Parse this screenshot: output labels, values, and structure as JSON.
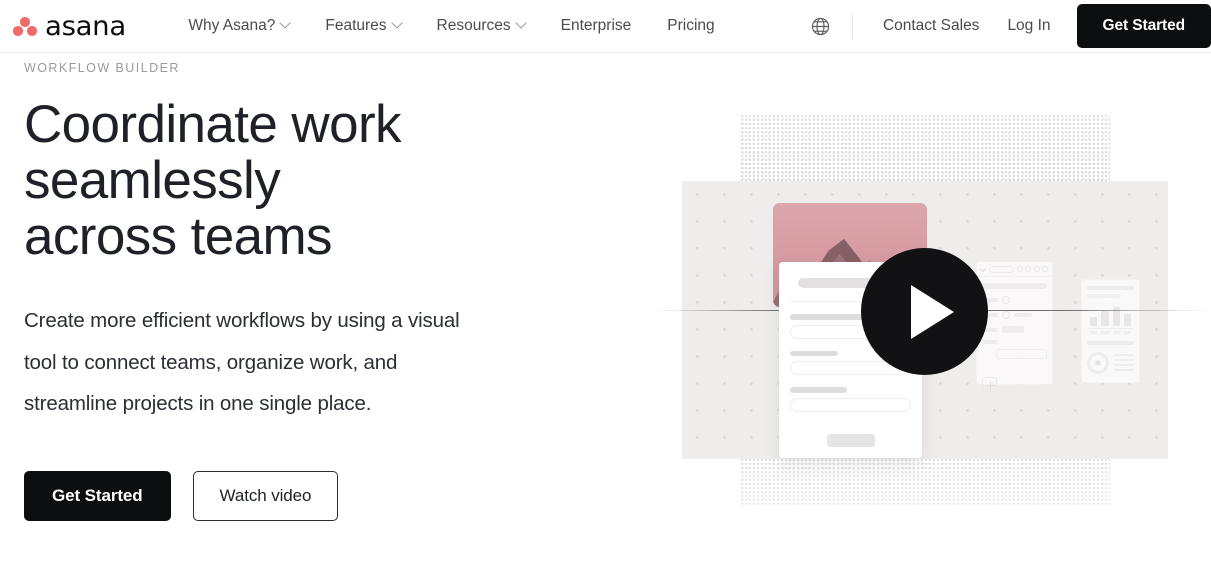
{
  "header": {
    "brand": {
      "name": "asana",
      "logo_icon": "asana-dots-logo",
      "dot_color": "#f06a6a"
    },
    "nav": [
      {
        "label": "Why Asana?",
        "has_dropdown": true
      },
      {
        "label": "Features",
        "has_dropdown": true
      },
      {
        "label": "Resources",
        "has_dropdown": true
      },
      {
        "label": "Enterprise",
        "has_dropdown": false
      },
      {
        "label": "Pricing",
        "has_dropdown": false
      }
    ],
    "language_icon": "globe-icon",
    "contact_sales_label": "Contact Sales",
    "log_in_label": "Log In",
    "get_started_label": "Get Started"
  },
  "hero": {
    "eyebrow": "WORKFLOW BUILDER",
    "title": "Coordinate work seamlessly across teams",
    "subtitle": "Create more efficient workflows by using a visual tool to connect teams, organize work, and streamline projects in one single place.",
    "primary_cta": "Get Started",
    "secondary_cta": "Watch video",
    "media": {
      "play_icon": "play-icon",
      "photo_subject": "mountain-peak-photo",
      "accent_color": "#d69aa1",
      "panel_color": "#efedec",
      "cta_color": "#0d0e10"
    }
  }
}
